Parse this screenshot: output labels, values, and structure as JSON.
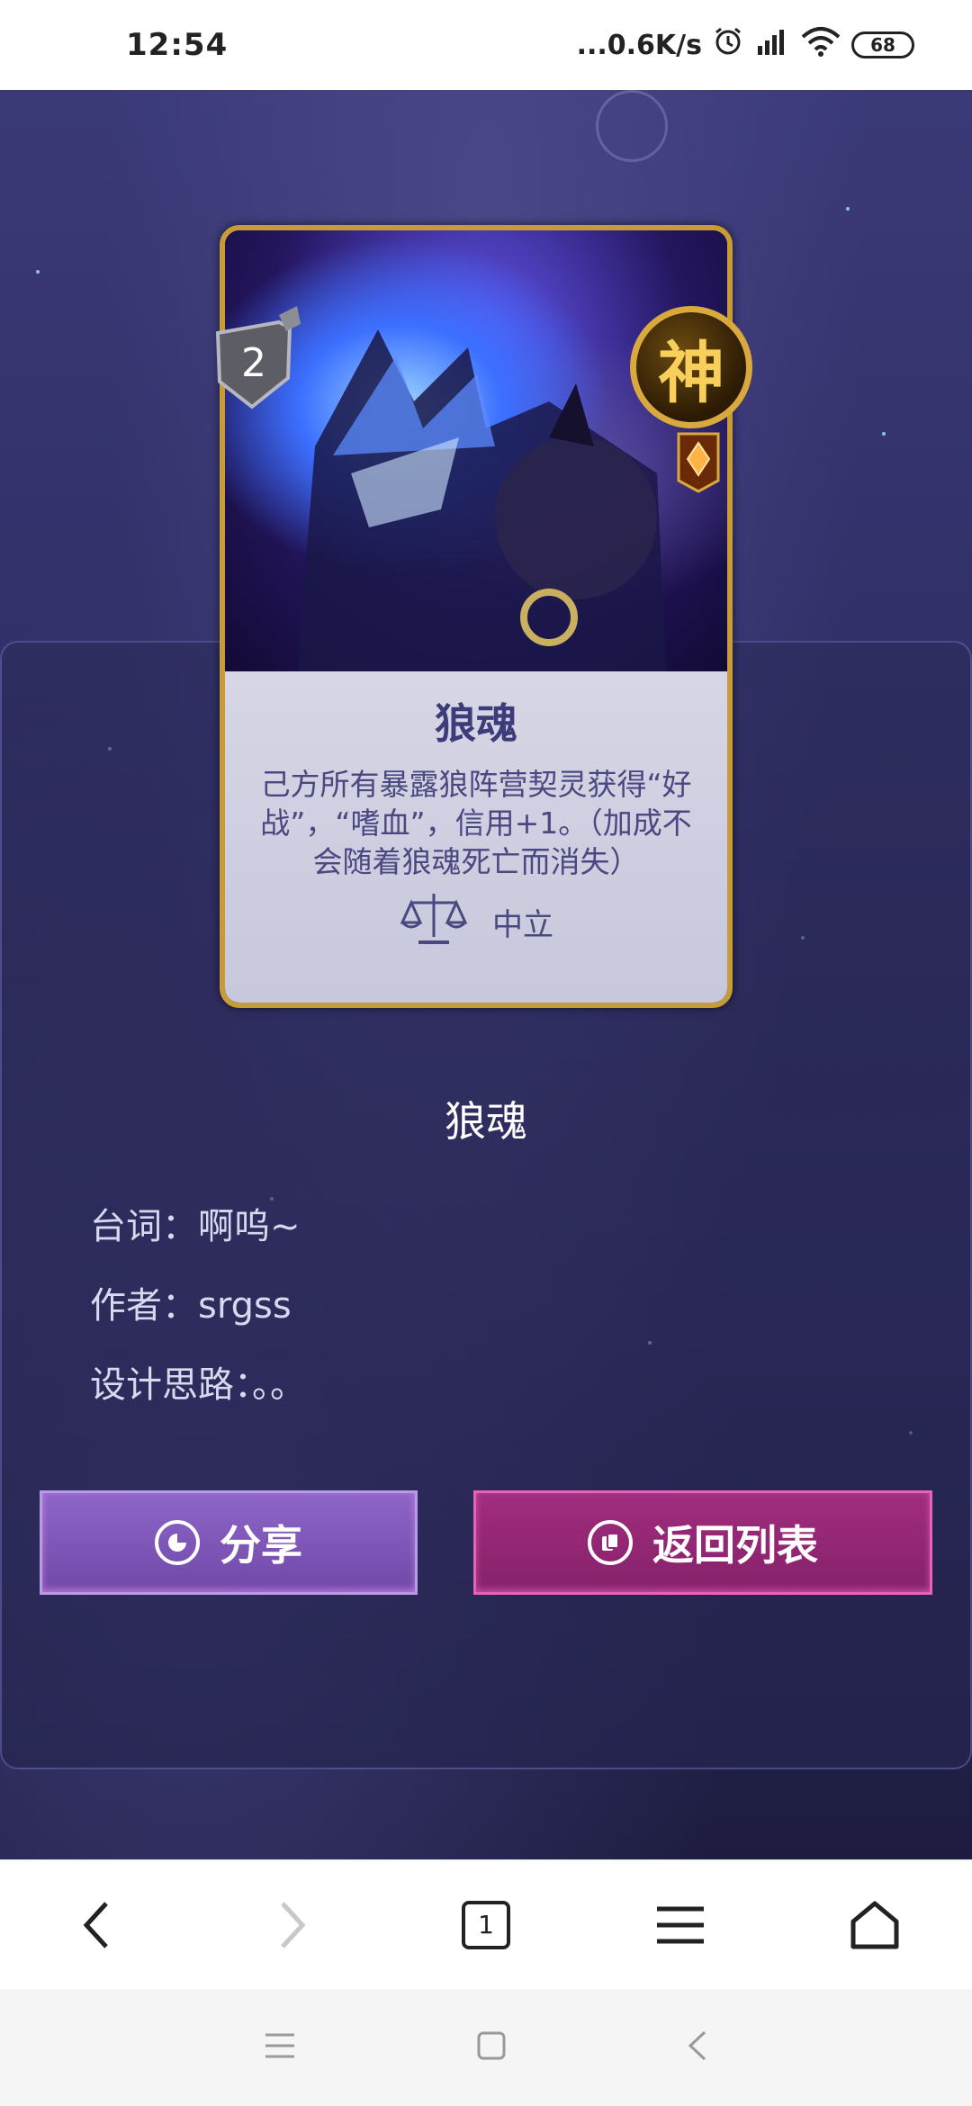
{
  "status_bar": {
    "time": "12:54",
    "network_speed": "...0.6K/s",
    "battery": "68",
    "icons": [
      "alarm-icon",
      "signal-icon",
      "wifi-icon",
      "battery-icon"
    ]
  },
  "card": {
    "cost": "2",
    "rarity_badge": "神",
    "name": "狼魂",
    "description": "己方所有暴露狼阵营契灵获得“好战”，“嗜血”，信用+1。（加成不会随着狼魂死亡而消失）",
    "faction": "中立",
    "icons": [
      "shield-icon",
      "gem-icon",
      "scales-icon"
    ]
  },
  "info": {
    "title": "狼魂",
    "line_label": "台词：",
    "line_value": "啊呜~",
    "author_label": "作者：",
    "author_value": "srgss",
    "design_label": "设计思路：",
    "design_value": "。。"
  },
  "buttons": {
    "share": "分享",
    "back_to_list": "返回列表"
  },
  "browser_toolbar": {
    "tab_count": "1",
    "icons": [
      "back-icon",
      "forward-icon",
      "tabs-icon",
      "menu-icon",
      "home-icon"
    ]
  },
  "system_nav": {
    "icons": [
      "recents-icon",
      "home-square-icon",
      "back-triangle-icon"
    ]
  },
  "colors": {
    "card_border": "#c79a3a",
    "share_button": "#7a55b6",
    "back_button": "#962676",
    "background": "#2e2d63"
  }
}
